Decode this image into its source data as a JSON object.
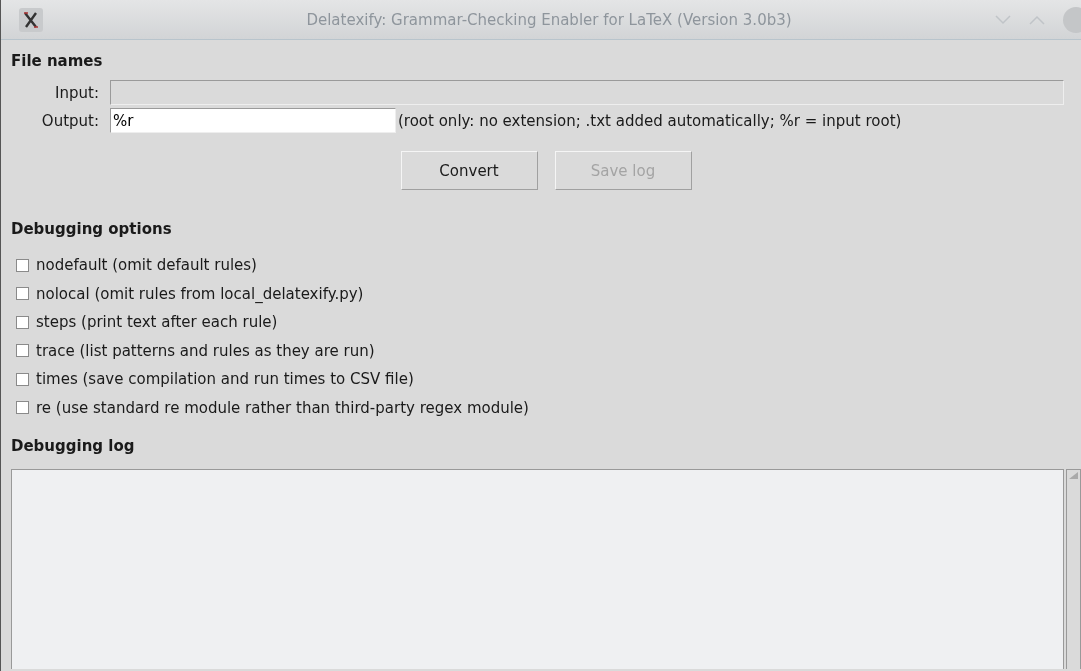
{
  "window": {
    "title": "Delatexify: Grammar-Checking Enabler for LaTeX (Version 3.0b3)"
  },
  "file_names": {
    "heading": "File names",
    "fields": [
      {
        "label": "Input:",
        "disabled": true
      },
      {
        "label": "Output:",
        "value": "%r",
        "disabled": false,
        "hint": "(root only: no extension; .txt added automatically; %r = input root)"
      }
    ],
    "buttons": [
      {
        "label": "Convert",
        "disabled": false
      },
      {
        "label": "Save log",
        "disabled": true
      }
    ]
  },
  "debugging_options": {
    "heading": "Debugging options",
    "options": [
      {
        "label": "nodefault (omit default rules)",
        "checked": false
      },
      {
        "label": "nolocal (omit rules from local_delatexify.py)",
        "checked": false
      },
      {
        "label": "steps (print text after each rule)",
        "checked": false
      },
      {
        "label": "trace (list patterns and rules as they are run)",
        "checked": false
      },
      {
        "label": "times (save compilation and run times to CSV file)",
        "checked": false
      },
      {
        "label": "re (use standard re module rather than third-party regex module)",
        "checked": false
      }
    ]
  },
  "debugging_log": {
    "heading": "Debugging log"
  }
}
